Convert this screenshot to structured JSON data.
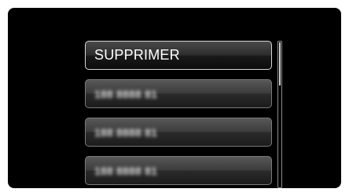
{
  "menu": {
    "items": [
      {
        "label": "SUPPRIMER",
        "state": "selected"
      },
      {
        "label": "188 8888 81",
        "state": "blurred"
      },
      {
        "label": "188 8888 81",
        "state": "blurred"
      },
      {
        "label": "188 8888 81",
        "state": "blurred"
      }
    ]
  },
  "scrollbar": {
    "position_fraction": 0.0,
    "visible_fraction": 0.3
  }
}
